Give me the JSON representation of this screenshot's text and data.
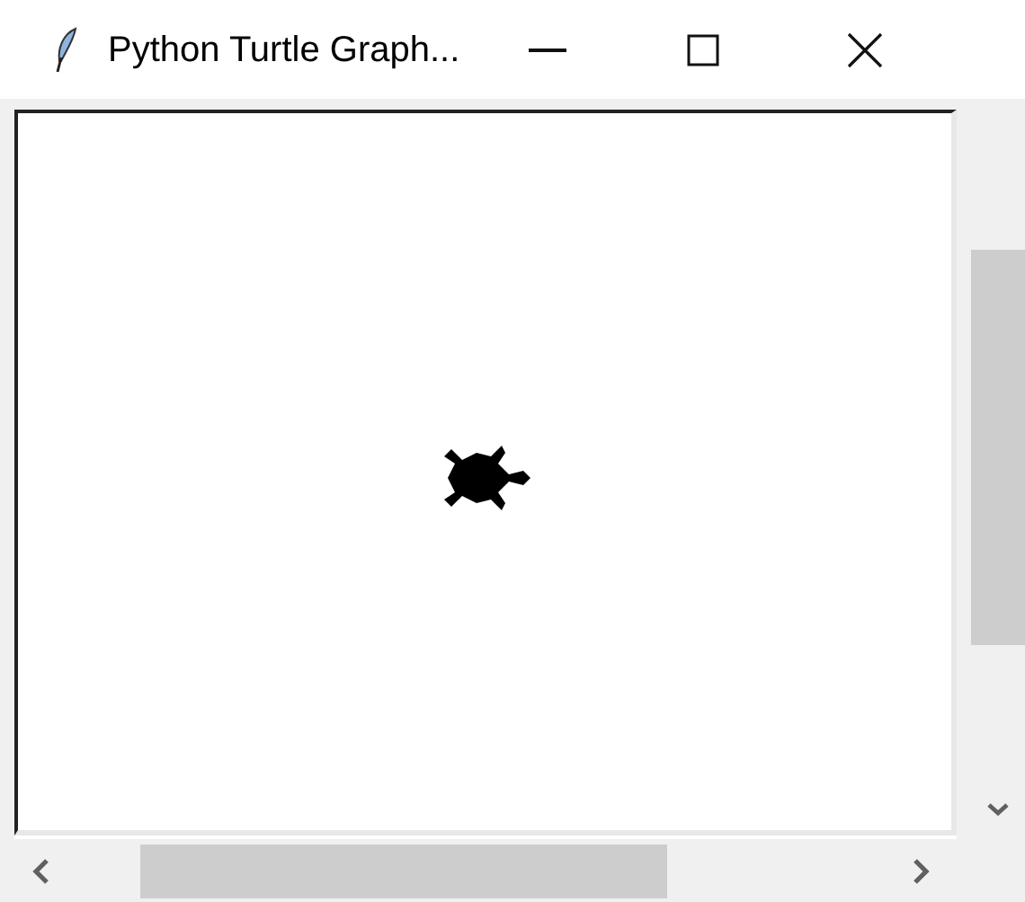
{
  "window": {
    "title": "Python Turtle Graph..."
  }
}
